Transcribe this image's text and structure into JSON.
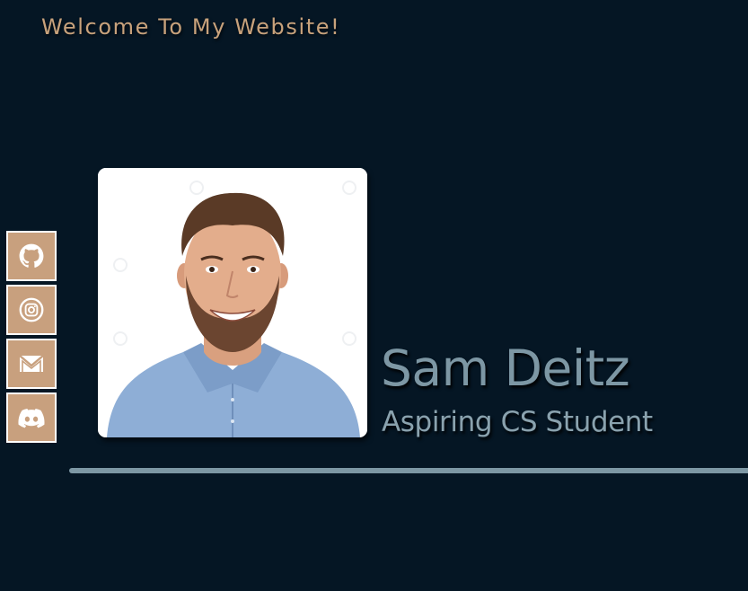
{
  "header": {
    "welcome_text": "Welcome To My Website!"
  },
  "social_links": [
    {
      "name": "github",
      "icon": "github-icon"
    },
    {
      "name": "instagram",
      "icon": "instagram-icon"
    },
    {
      "name": "email",
      "icon": "mail-icon"
    },
    {
      "name": "discord",
      "icon": "discord-icon"
    }
  ],
  "profile": {
    "name": "Sam Deitz",
    "subtitle": "Aspiring CS Student"
  },
  "colors": {
    "background": "#051624",
    "accent_tan": "#c8a07e",
    "name_color": "#7d97a4",
    "divider": "#7d97a4"
  }
}
